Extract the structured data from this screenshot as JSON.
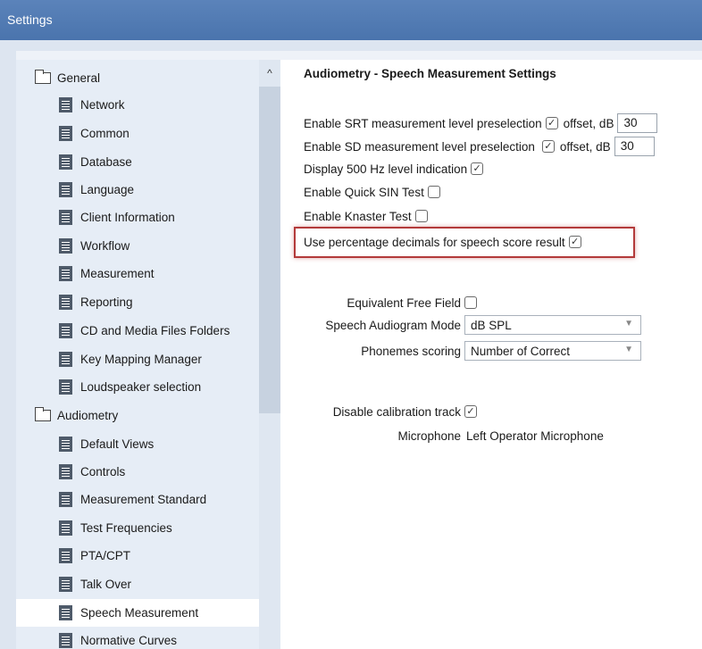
{
  "window": {
    "title": "Settings"
  },
  "sidebar": {
    "items": [
      {
        "label": "General",
        "level": 1,
        "icon": "folder-icon"
      },
      {
        "label": "Network",
        "level": 2,
        "icon": "document-icon"
      },
      {
        "label": "Common",
        "level": 2,
        "icon": "document-icon"
      },
      {
        "label": "Database",
        "level": 2,
        "icon": "document-icon"
      },
      {
        "label": "Language",
        "level": 2,
        "icon": "document-icon"
      },
      {
        "label": "Client Information",
        "level": 2,
        "icon": "document-icon"
      },
      {
        "label": "Workflow",
        "level": 2,
        "icon": "document-icon"
      },
      {
        "label": "Measurement",
        "level": 2,
        "icon": "document-icon"
      },
      {
        "label": "Reporting",
        "level": 2,
        "icon": "document-icon"
      },
      {
        "label": "CD and Media Files Folders",
        "level": 2,
        "icon": "document-icon"
      },
      {
        "label": "Key Mapping Manager",
        "level": 2,
        "icon": "document-icon"
      },
      {
        "label": "Loudspeaker selection",
        "level": 2,
        "icon": "document-icon"
      },
      {
        "label": "Audiometry",
        "level": 1,
        "icon": "folder-icon"
      },
      {
        "label": "Default Views",
        "level": 2,
        "icon": "document-icon"
      },
      {
        "label": "Controls",
        "level": 2,
        "icon": "document-icon"
      },
      {
        "label": "Measurement Standard",
        "level": 2,
        "icon": "document-icon"
      },
      {
        "label": "Test Frequencies",
        "level": 2,
        "icon": "document-icon"
      },
      {
        "label": "PTA/CPT",
        "level": 2,
        "icon": "document-icon"
      },
      {
        "label": "Talk Over",
        "level": 2,
        "icon": "document-icon"
      },
      {
        "label": "Speech Measurement",
        "level": 2,
        "icon": "document-icon",
        "selected": true
      },
      {
        "label": "Normative Curves",
        "level": 2,
        "icon": "document-icon"
      }
    ],
    "scroll_up_glyph": "^"
  },
  "main": {
    "section_title": "Audiometry - Speech Measurement Settings",
    "srt": {
      "label": "Enable SRT measurement level preselection",
      "checked": true,
      "offset_label": "offset, dB",
      "offset_value": "30"
    },
    "sd": {
      "label": "Enable SD measurement level preselection",
      "checked": true,
      "offset_label": "offset, dB",
      "offset_value": "30"
    },
    "display_500": {
      "label": "Display 500 Hz level indication",
      "checked": true
    },
    "quick_sin": {
      "label": "Enable Quick SIN Test",
      "checked": false
    },
    "knaster": {
      "label": "Enable Knaster Test",
      "checked": false
    },
    "percentage": {
      "label": "Use percentage decimals for speech score result",
      "checked": true
    },
    "equivalent_free_field": {
      "label": "Equivalent Free Field",
      "checked": false
    },
    "speech_audiogram_mode": {
      "label": "Speech Audiogram Mode",
      "value": "dB SPL"
    },
    "phonemes_scoring": {
      "label": "Phonemes scoring",
      "value": "Number of Correct"
    },
    "disable_calibration": {
      "label": "Disable calibration track",
      "checked": true
    },
    "microphone": {
      "label": "Microphone",
      "value": "Left Operator Microphone"
    }
  },
  "glyphs": {
    "check": "✓",
    "dropdown": "▼"
  },
  "colors": {
    "titlebar": "#4a74ad",
    "highlight_border": "#b33a3a",
    "selected_item": "#ffffff"
  }
}
